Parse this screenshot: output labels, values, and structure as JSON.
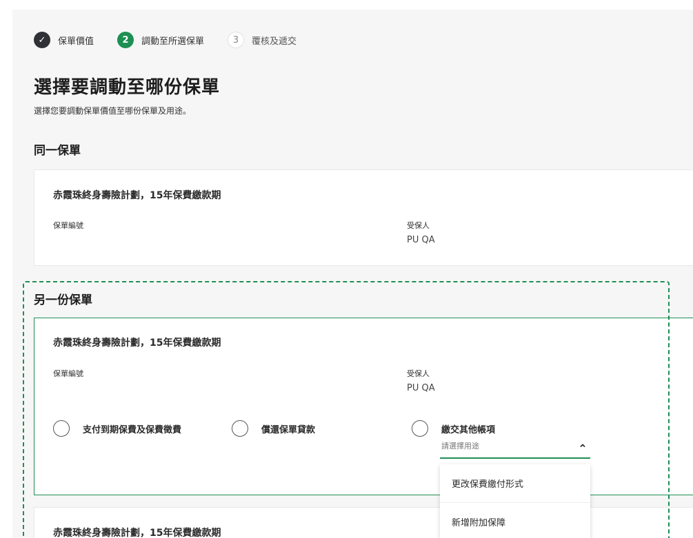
{
  "stepper": {
    "steps": [
      {
        "number": "✓",
        "label": "保單價值",
        "state": "done"
      },
      {
        "number": "2",
        "label": "調動至所選保單",
        "state": "active"
      },
      {
        "number": "3",
        "label": "覆核及遞交",
        "state": "pending"
      }
    ]
  },
  "page": {
    "title": "選擇要調動至哪份保單",
    "subtitle": "選擇您要調動保單價值至哪份保單及用途。"
  },
  "same_policy": {
    "section_title": "同一保單",
    "card": {
      "plan_name": "赤霞珠終身壽險計劃，15年保費繳款期",
      "policy_number_label": "保單編號",
      "insured_label": "受保人",
      "insured_value": "PU QA"
    }
  },
  "other_policy": {
    "section_title": "另一份保單",
    "card": {
      "plan_name": "赤霞珠終身壽險計劃，15年保費繳款期",
      "policy_number_label": "保單編號",
      "insured_label": "受保人",
      "insured_value": "PU QA",
      "options": [
        {
          "label": "支付到期保費及保費徵費"
        },
        {
          "label": "償還保單貸款"
        },
        {
          "label": "繳交其他帳項"
        }
      ],
      "select_placeholder": "請選擇用途",
      "dropdown_items": [
        "更改保費繳付形式",
        "新增附加保障"
      ]
    },
    "next_card": {
      "plan_name": "赤霞珠終身壽險計劃，15年保費繳款期"
    }
  },
  "colors": {
    "accent_green": "#1e8f52",
    "step_done": "#2f3136",
    "panel_bg": "#f6f6f6"
  }
}
